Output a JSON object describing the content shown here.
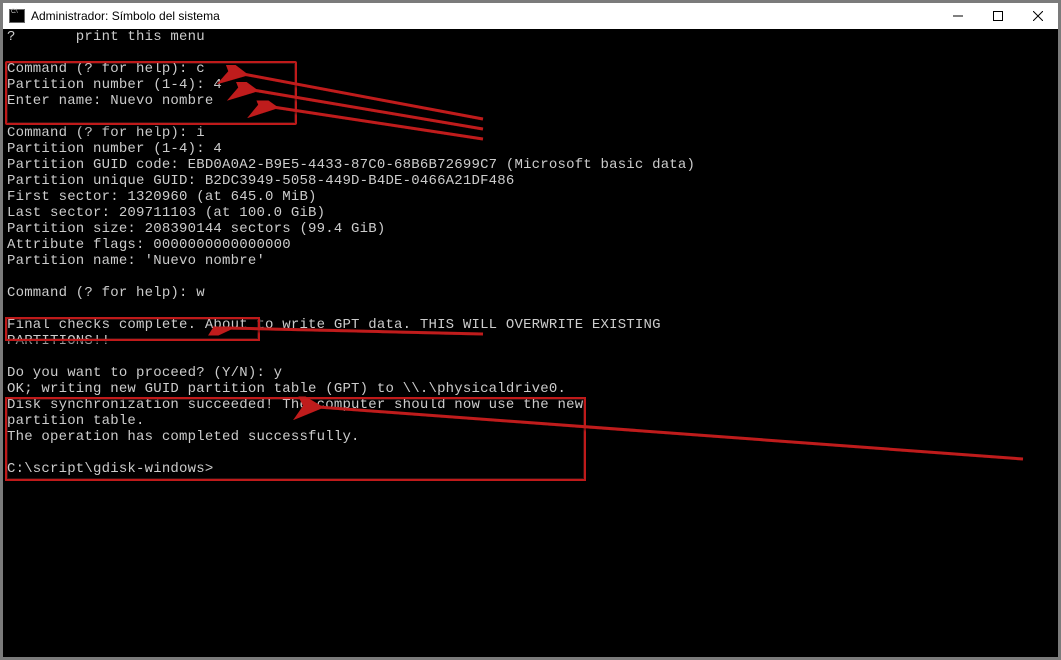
{
  "window": {
    "title": "Administrador: Símbolo del sistema"
  },
  "terminal": {
    "lines": [
      "?       print this menu",
      "",
      "Command (? for help): c",
      "Partition number (1-4): 4",
      "Enter name: Nuevo nombre",
      "",
      "Command (? for help): i",
      "Partition number (1-4): 4",
      "Partition GUID code: EBD0A0A2-B9E5-4433-87C0-68B6B72699C7 (Microsoft basic data)",
      "Partition unique GUID: B2DC3949-5058-449D-B4DE-0466A21DF486",
      "First sector: 1320960 (at 645.0 MiB)",
      "Last sector: 209711103 (at 100.0 GiB)",
      "Partition size: 208390144 sectors (99.4 GiB)",
      "Attribute flags: 0000000000000000",
      "Partition name: 'Nuevo nombre'",
      "",
      "Command (? for help): w",
      "",
      "Final checks complete. About to write GPT data. THIS WILL OVERWRITE EXISTING",
      "PARTITIONS!!",
      "",
      "Do you want to proceed? (Y/N): y",
      "OK; writing new GUID partition table (GPT) to \\\\.\\physicaldrive0.",
      "Disk synchronization succeeded! The computer should now use the new",
      "partition table.",
      "The operation has completed successfully.",
      "",
      "C:\\script\\gdisk-windows>"
    ]
  },
  "annotations": {
    "color": "#bf1a1a"
  }
}
